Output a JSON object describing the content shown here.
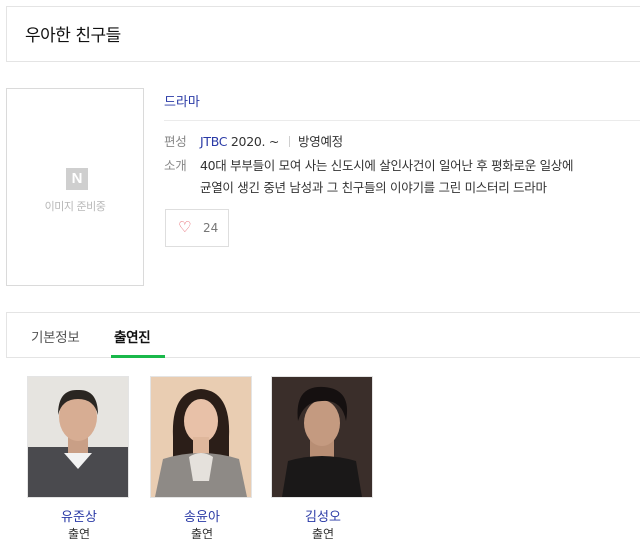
{
  "title": "우아한 친구들",
  "poster": {
    "logo_letter": "N",
    "caption": "이미지 준비중"
  },
  "genre": "드라마",
  "info": {
    "broadcast_label": "편성",
    "channel": "JTBC",
    "year": "2020. ~",
    "status": "방영예정",
    "summary_label": "소개",
    "summary_line1": "40대 부부들이 모여 사는 신도시에 살인사건이 일어난 후 평화로운 일상에",
    "summary_line2": "균열이 생긴 중년 남성과 그 친구들의 이야기를 그린 미스터리 드라마"
  },
  "like": {
    "icon": "heart-icon",
    "count": "24",
    "color": "#e35560"
  },
  "tabs": [
    {
      "label": "기본정보"
    },
    {
      "label": "출연진"
    }
  ],
  "accent": "#19b84a",
  "link_color": "#2a3aa6",
  "cast": [
    {
      "name": "유준상",
      "role": "출연"
    },
    {
      "name": "송윤아",
      "role": "출연"
    },
    {
      "name": "김성오",
      "role": "출연"
    }
  ]
}
